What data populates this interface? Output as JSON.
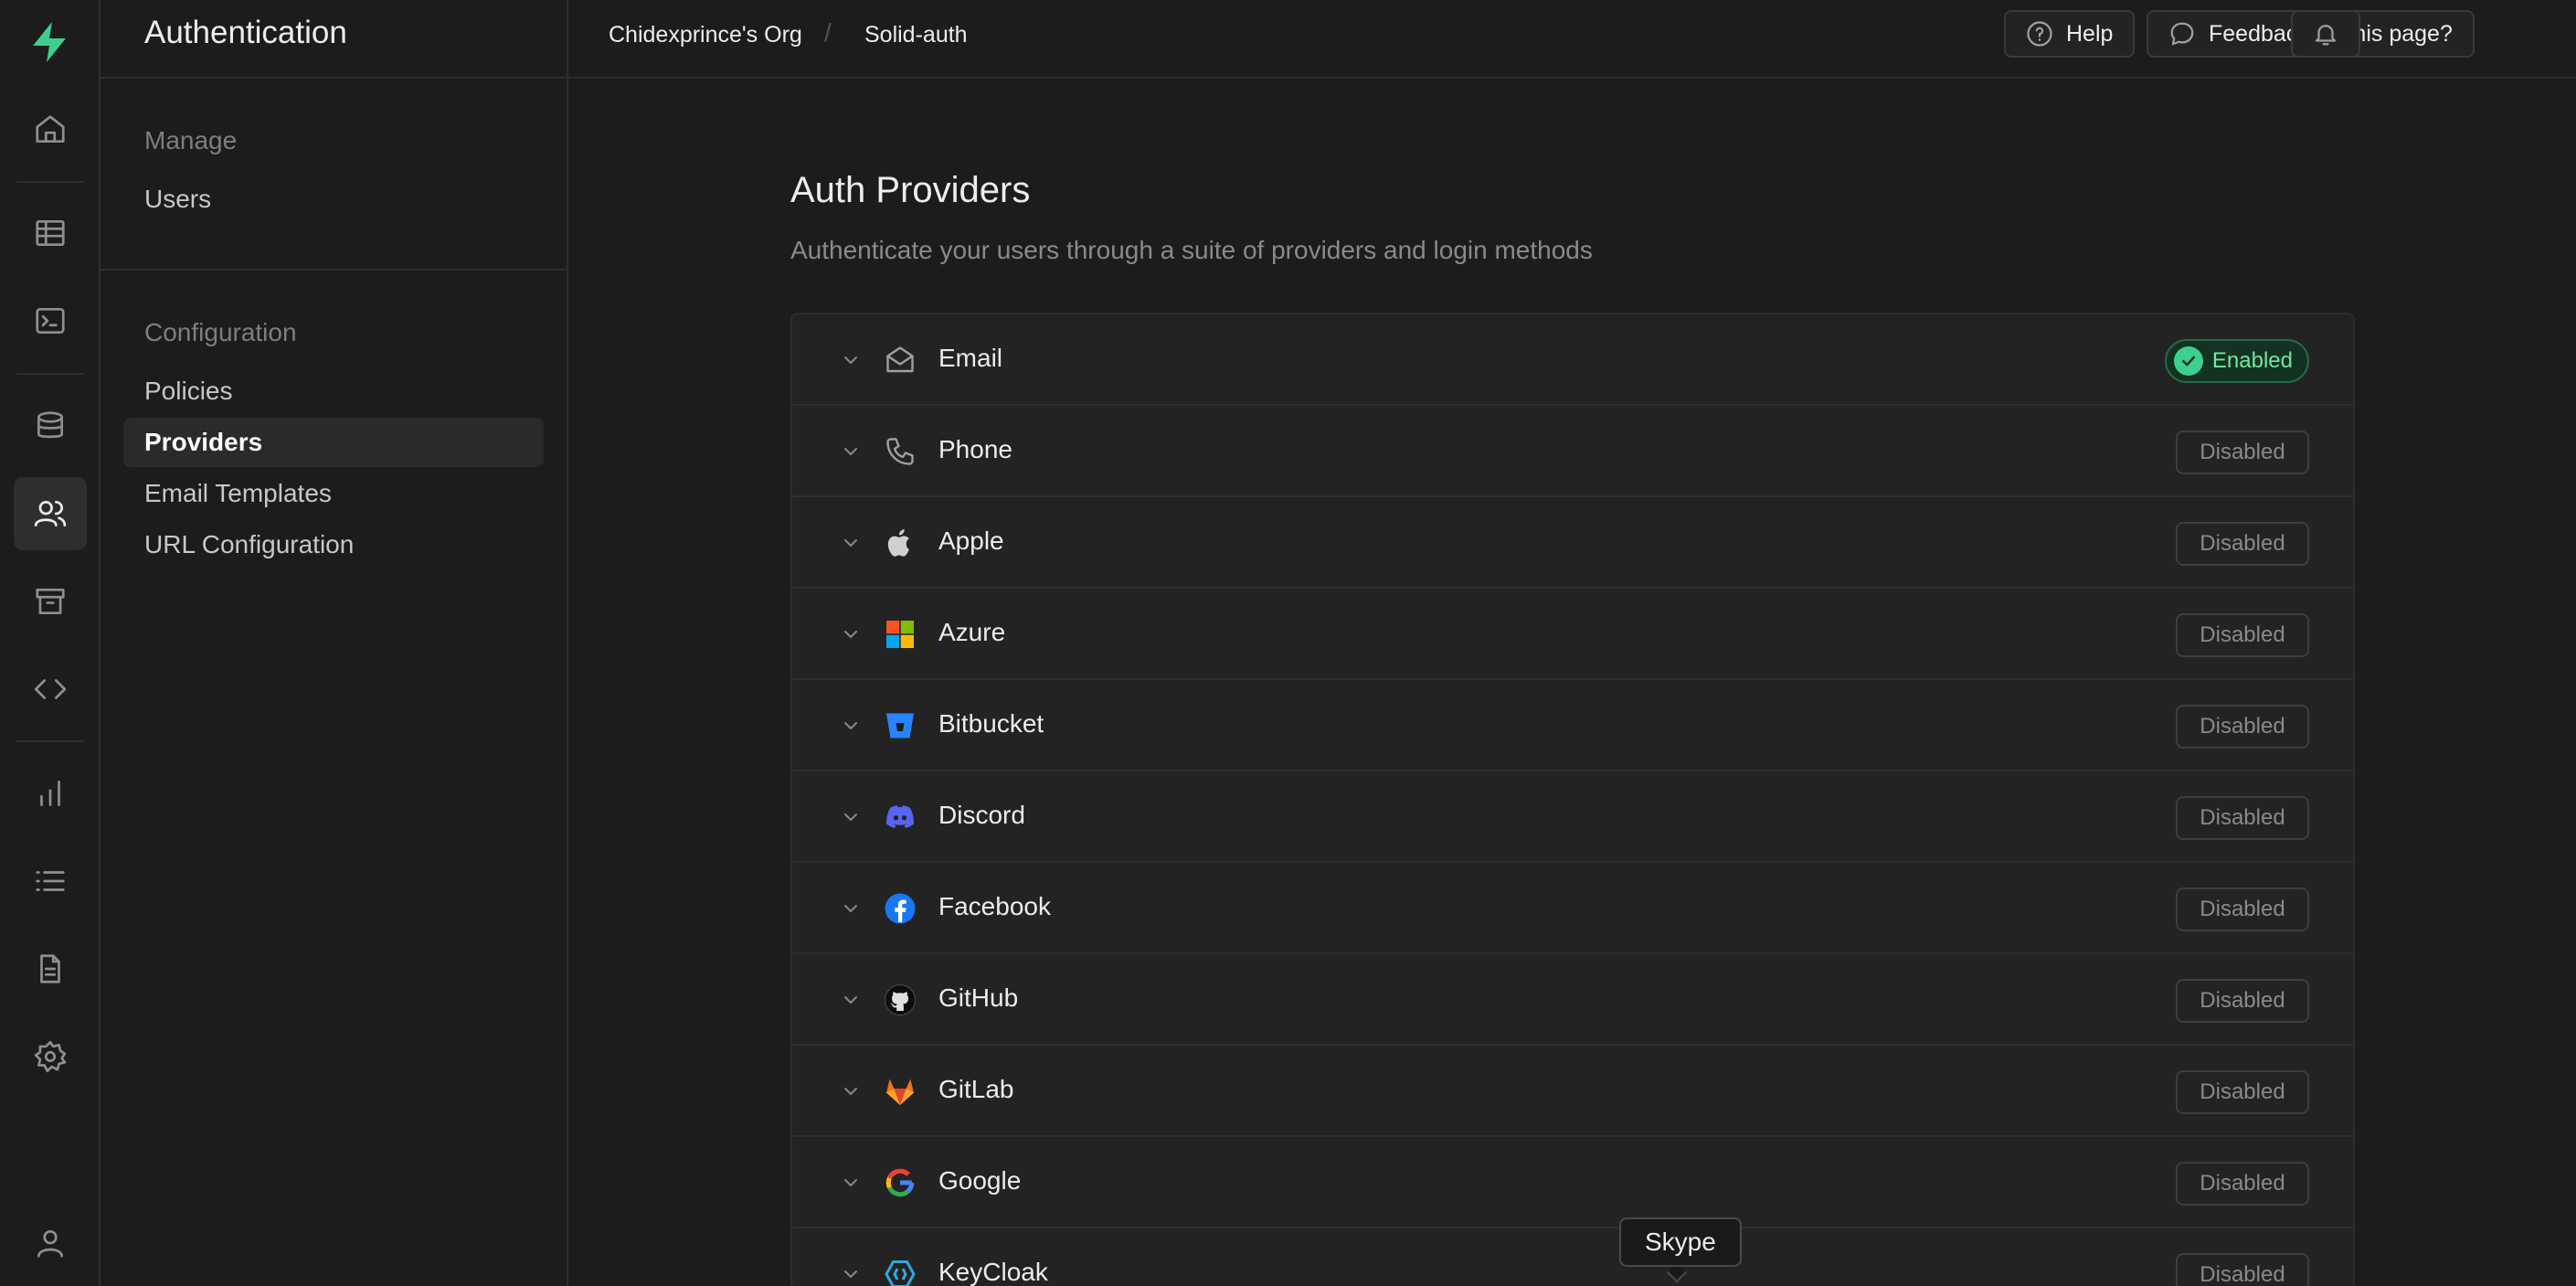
{
  "rail": {
    "items": [
      {
        "icon": "home-icon"
      },
      {
        "icon": "table-editor-icon"
      },
      {
        "icon": "sql-editor-icon"
      },
      {
        "icon": "database-icon"
      },
      {
        "icon": "auth-users-icon"
      },
      {
        "icon": "storage-icon"
      },
      {
        "icon": "edge-functions-icon"
      },
      {
        "icon": "reports-icon"
      },
      {
        "icon": "logs-icon"
      },
      {
        "icon": "api-docs-icon"
      },
      {
        "icon": "settings-icon"
      },
      {
        "icon": "user-icon"
      }
    ],
    "brand_color": "#3ecf8e"
  },
  "sidebar": {
    "title": "Authentication",
    "manage_label": "Manage",
    "manage_items": [
      {
        "label": "Users"
      }
    ],
    "config_label": "Configuration",
    "config_items": [
      {
        "label": "Policies"
      },
      {
        "label": "Providers",
        "active": true
      },
      {
        "label": "Email Templates"
      },
      {
        "label": "URL Configuration"
      }
    ]
  },
  "topbar": {
    "org": "Chidexprince's Org",
    "separator": "/",
    "project": "Solid-auth",
    "help_label": "Help",
    "feedback_label": "Feedback on this page?"
  },
  "main": {
    "title": "Auth Providers",
    "subtitle": "Authenticate your users through a suite of providers and login methods"
  },
  "providers": [
    {
      "name": "Email",
      "icon": "email-icon",
      "status": "Enabled"
    },
    {
      "name": "Phone",
      "icon": "phone-icon",
      "status": "Disabled"
    },
    {
      "name": "Apple",
      "icon": "apple-icon",
      "status": "Disabled"
    },
    {
      "name": "Azure",
      "icon": "azure-icon",
      "status": "Disabled"
    },
    {
      "name": "Bitbucket",
      "icon": "bitbucket-icon",
      "status": "Disabled"
    },
    {
      "name": "Discord",
      "icon": "discord-icon",
      "status": "Disabled"
    },
    {
      "name": "Facebook",
      "icon": "facebook-icon",
      "status": "Disabled"
    },
    {
      "name": "GitHub",
      "icon": "github-icon",
      "status": "Disabled"
    },
    {
      "name": "GitLab",
      "icon": "gitlab-icon",
      "status": "Disabled"
    },
    {
      "name": "Google",
      "icon": "google-icon",
      "status": "Disabled"
    },
    {
      "name": "KeyCloak",
      "icon": "keycloak-icon",
      "status": "Disabled"
    }
  ],
  "tooltip": {
    "text": "Skype"
  },
  "colors": {
    "enabled": "#3ecf8e",
    "background": "#1c1c1c",
    "panel": "#232323"
  }
}
